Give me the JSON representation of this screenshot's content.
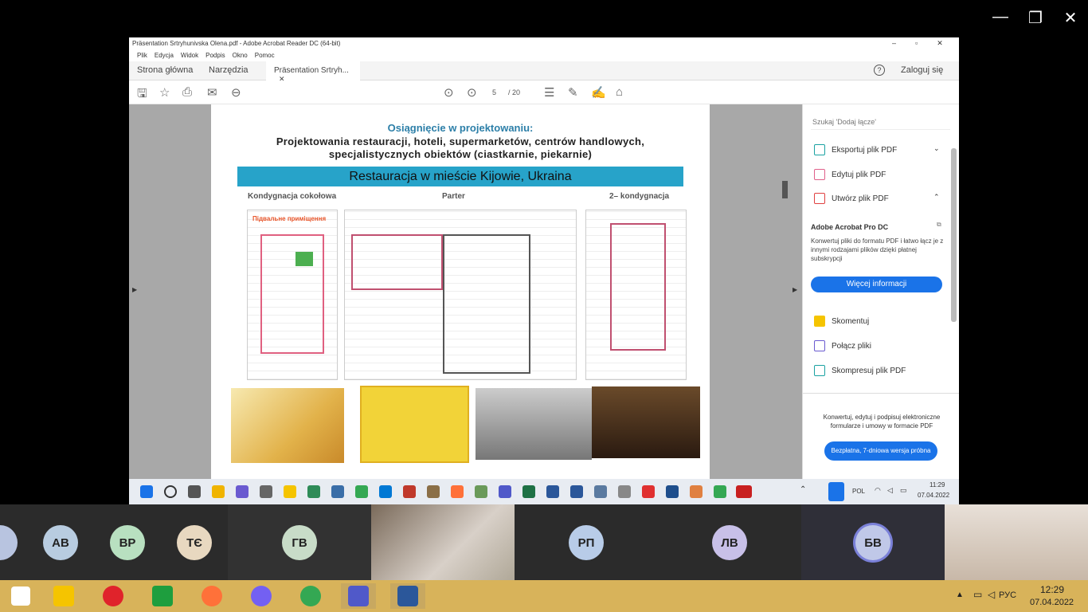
{
  "acrobat": {
    "title": "Präsentation Srtryhunivska Olena.pdf - Adobe Acrobat Reader DC (64-bit)",
    "menu": [
      "Plik",
      "Edycja",
      "Widok",
      "Podpis",
      "Okno",
      "Pomoc"
    ],
    "tabs": {
      "home": "Strona główna",
      "tools": "Narzędzia",
      "doc": "Präsentation Srtryh..."
    },
    "sign_in": "Zaloguj się",
    "page_current": "5",
    "page_total": "/ 20"
  },
  "slide": {
    "title": "Osiągnięcie  w projektowaniu:",
    "subtitle_line1": "Projektowania restauracji, hoteli, supermarketów, centrów handlowych,",
    "subtitle_line2": "specjalistycznych obiektów (ciastkarnie, piekarnie)",
    "banner": "Restauracja w mieście Kijowie, Ukraina",
    "col1": "Kondygnacja cokołowa",
    "col2": "Parter",
    "col3": "2– kondygnacja",
    "plan1_label": "Підвальне приміщення"
  },
  "panel": {
    "search_placeholder": "Szukaj 'Dodaj łącze'",
    "export": "Eksportuj plik PDF",
    "edit": "Edytuj plik PDF",
    "create": "Utwórz plik PDF",
    "pro_title": "Adobe Acrobat Pro DC",
    "pro_desc": "Konwertuj pliki do formatu PDF i łatwo łącz je z innymi rodzajami plików dzięki płatnej subskrypcji",
    "more_info": "Więcej informacji",
    "comment": "Skomentuj",
    "combine": "Połącz pliki",
    "compress": "Skompresuj plik PDF",
    "footer_text": "Konwertuj, edytuj i podpisuj elektroniczne formularze i umowy w formacie PDF",
    "trial": "Bezpłatna, 7-dniowa wersja próbna"
  },
  "inner_taskbar": {
    "lang": "POL",
    "time": "11:29",
    "date": "07.04.2022"
  },
  "participants": [
    "AB",
    "BP",
    "TЄ",
    "ГВ",
    "РП",
    "ЛВ",
    "БВ"
  ],
  "taskbar": {
    "lang": "РУС",
    "time": "12:29",
    "date": "07.04.2022"
  },
  "colors": {
    "banner": "#27a3c9",
    "accent": "#1a73e8",
    "taskbar": "#d8b35a"
  }
}
